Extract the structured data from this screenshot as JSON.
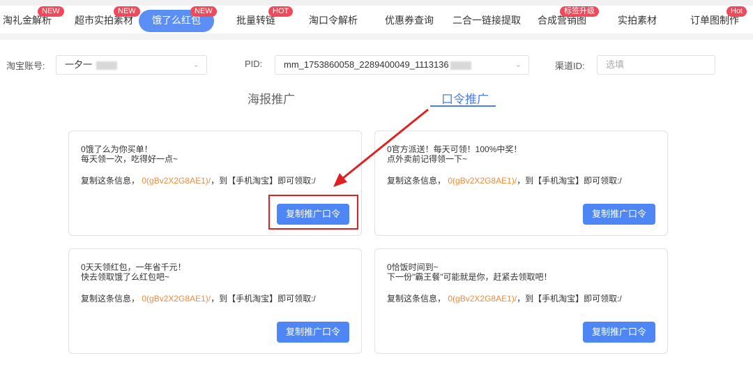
{
  "tabs": [
    {
      "label": "淘礼金解析",
      "badge": "NEW"
    },
    {
      "label": "超市实拍素材",
      "badge": "NEW"
    },
    {
      "label": "饿了么红包",
      "badge": "NEW",
      "active": true
    },
    {
      "label": "批量转链",
      "badge": "HOT"
    },
    {
      "label": "淘口令解析",
      "badge": ""
    },
    {
      "label": "优惠券查询",
      "badge": ""
    },
    {
      "label": "二合一链接提取",
      "badge": ""
    },
    {
      "label": "合成营销图",
      "badge": "标签升级"
    },
    {
      "label": "实拍素材",
      "badge": ""
    },
    {
      "label": "订单图制作",
      "badge": "Hot"
    }
  ],
  "filters": {
    "account_label": "淘宝账号:",
    "account_value": "一夕一 ",
    "pid_label": "PID:",
    "pid_value": "mm_1753860058_2289400049_1113136",
    "channel_label": "渠道ID:",
    "channel_placeholder": "选填"
  },
  "modes": {
    "poster": "海报推广",
    "command": "口令推广",
    "active": "command"
  },
  "cards": [
    {
      "line1": "0饿了么为你买单！",
      "line2": "每天领一次，吃得好一点~",
      "copy_prefix": "复制这条信息，",
      "code": "0(gBv2X2G8AE1)/",
      "copy_suffix": "，到【手机淘宝】即可领取:/",
      "button": "复制推广口令"
    },
    {
      "line1": "0官方派送！每天可领！100%中奖！",
      "line2": "点外卖前记得领一下~",
      "copy_prefix": "复制这条信息，",
      "code": "0(gBv2X2G8AE1)/",
      "copy_suffix": "，到【手机淘宝】即可领取:/",
      "button": "复制推广口令"
    },
    {
      "line1": "0天天领红包，一年省千元！",
      "line2": "快去领取饿了么红包吧~",
      "copy_prefix": "复制这条信息，",
      "code": "0(gBv2X2G8AE1)/",
      "copy_suffix": "，到【手机淘宝】即可领取:/",
      "button": "复制推广口令"
    },
    {
      "line1": "0恰饭时间到~",
      "line2": "下一份\"霸王餐\"可能就是你，赶紧去领取吧！",
      "copy_prefix": "复制这条信息，",
      "code": "0(gBv2X2G8AE1)/",
      "copy_suffix": "，到【手机淘宝】即可领取:/",
      "button": "复制推广口令"
    }
  ],
  "colors": {
    "accent": "#4e86f5",
    "badge": "#f04a5a",
    "code": "#f08a3c",
    "annotation": "#e02020"
  }
}
